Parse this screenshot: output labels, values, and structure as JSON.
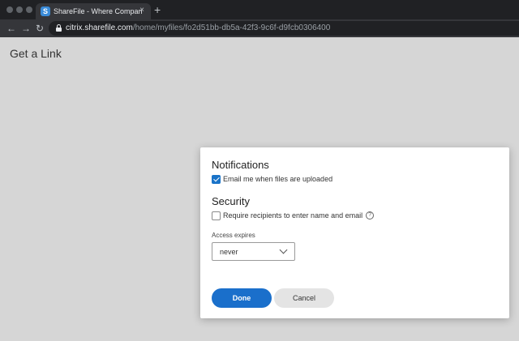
{
  "browser": {
    "tab": {
      "favicon_letter": "S",
      "title": "ShareFile - Where Companies",
      "close_glyph": "×"
    },
    "new_tab_glyph": "+",
    "nav": {
      "back": "←",
      "forward": "→",
      "reload": "↻"
    },
    "url": {
      "host": "citrix.sharefile.com",
      "path": "/home/myfiles/fo2d51bb-db5a-42f3-9c6f-d9fcb0306400"
    }
  },
  "page": {
    "title": "Get a Link"
  },
  "dialog": {
    "notifications": {
      "heading": "Notifications",
      "email_option": {
        "label": "Email me when files are uploaded",
        "checked": true
      }
    },
    "security": {
      "heading": "Security",
      "require_option": {
        "label": "Require recipients to enter name and email",
        "checked": false
      },
      "help_glyph": "?"
    },
    "access_expires": {
      "label": "Access expires",
      "value": "never"
    },
    "buttons": {
      "done": "Done",
      "cancel": "Cancel"
    }
  },
  "colors": {
    "accent": "#1a6fcb",
    "background": "#d6d6d6"
  },
  "icons": [
    "lock-icon",
    "chevron-down-icon",
    "help-icon",
    "close-icon"
  ]
}
